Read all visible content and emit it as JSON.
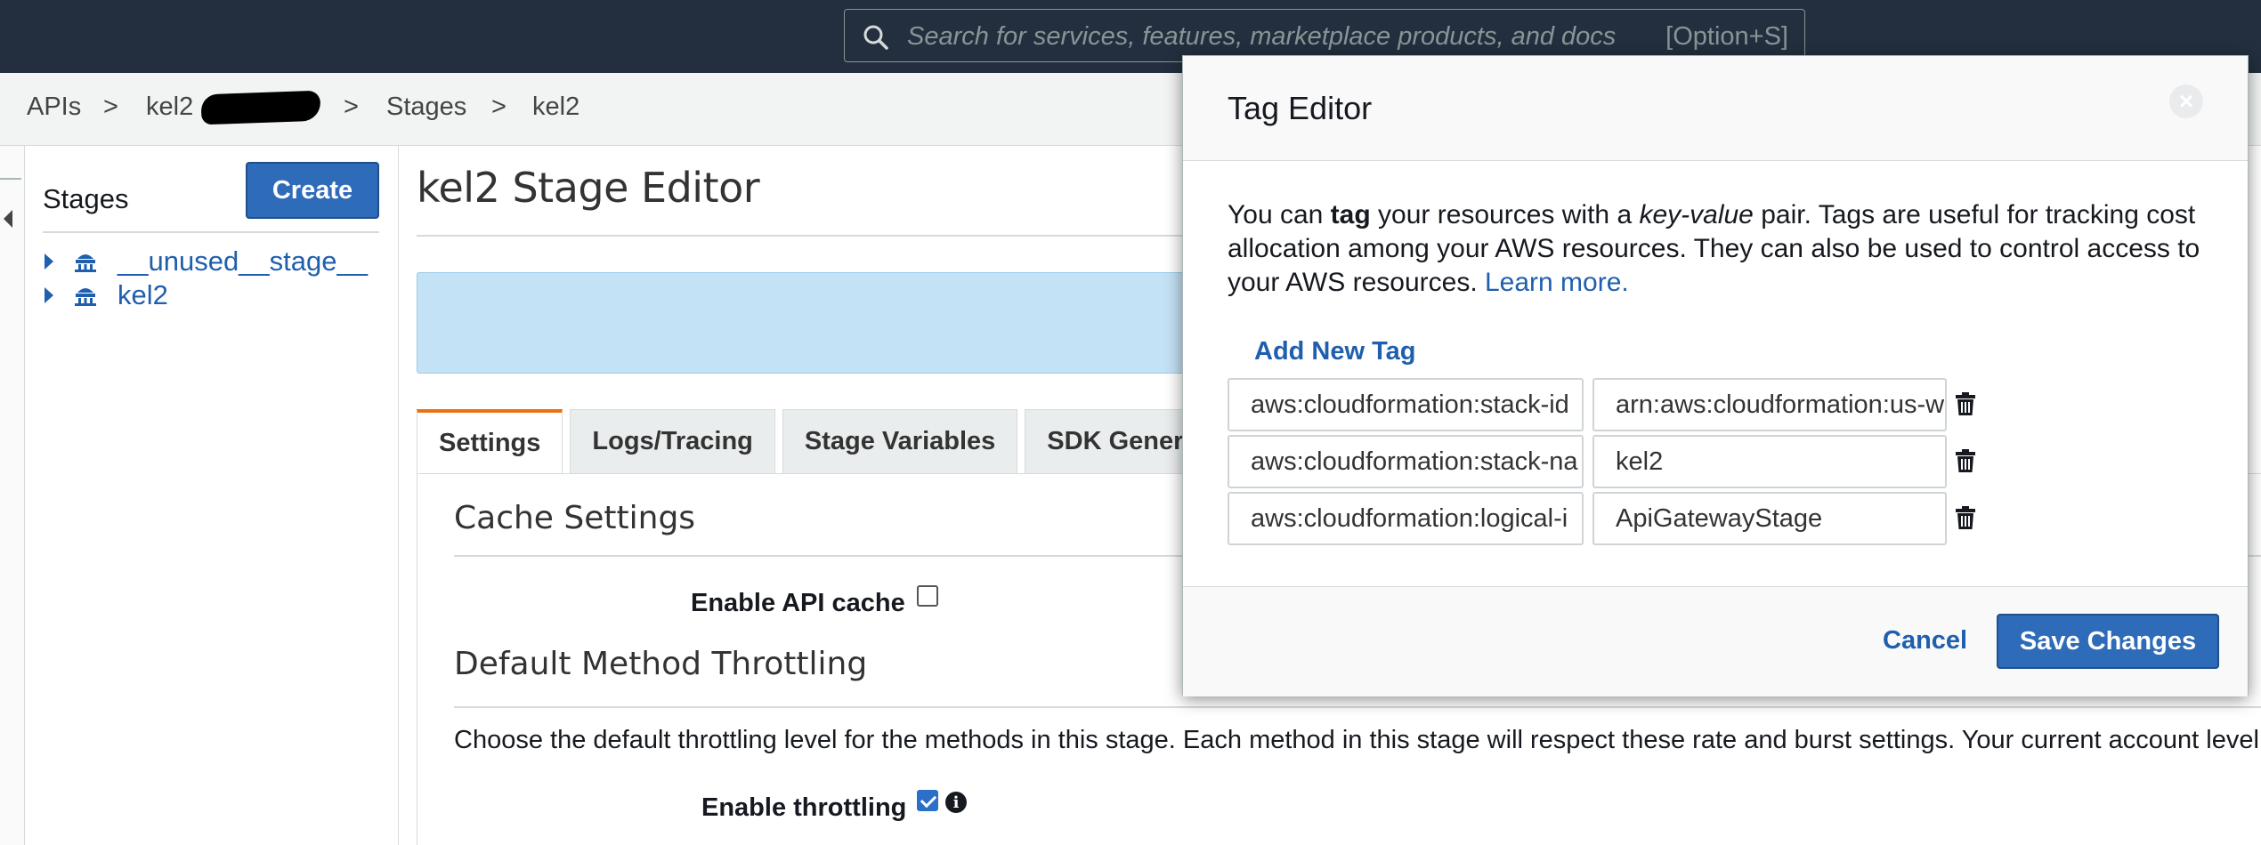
{
  "search": {
    "placeholder": "Search for services, features, marketplace products, and docs",
    "shortcut": "[Option+S]"
  },
  "breadcrumb": {
    "items": [
      "APIs",
      ">",
      "kel2",
      ">",
      "Stages",
      ">",
      "kel2"
    ]
  },
  "stages_panel": {
    "title": "Stages",
    "create_label": "Create",
    "items": [
      {
        "label": "__unused__stage__",
        "icon": "stage-icon"
      },
      {
        "label": "kel2",
        "icon": "stage-icon"
      }
    ]
  },
  "editor": {
    "title": "kel2 Stage Editor",
    "tabs": [
      "Settings",
      "Logs/Tracing",
      "Stage Variables",
      "SDK Generat"
    ],
    "cache_heading": "Cache Settings",
    "enable_cache_label": "Enable API cache",
    "enable_cache_checked": false,
    "throttling_heading": "Default Method Throttling",
    "throttling_desc": "Choose the default throttling level for the methods in this stage. Each method in this stage will respect these rate and burst settings. Your current account level thr",
    "enable_throttling_label": "Enable throttling",
    "enable_throttling_checked": true
  },
  "modal": {
    "title": "Tag Editor",
    "desc_parts": {
      "p1": "You can ",
      "bold": "tag",
      "p2": " your resources with a ",
      "italic": "key-value",
      "p3": " pair. Tags are useful for tracking cost allocation among your AWS resources. They can also be used to control access to your AWS resources. ",
      "link": "Learn more."
    },
    "add_tag_label": "Add New Tag",
    "tags": [
      {
        "key": "aws:cloudformation:stack-id",
        "value": "arn:aws:cloudformation:us-w"
      },
      {
        "key": "aws:cloudformation:stack-na",
        "value": "kel2"
      },
      {
        "key": "aws:cloudformation:logical-i",
        "value": "ApiGatewayStage"
      }
    ],
    "cancel_label": "Cancel",
    "save_label": "Save Changes"
  },
  "colors": {
    "nav_bg": "#232f3e",
    "primary_button": "#2e6bb8",
    "link": "#1f5fae",
    "tab_accent": "#ec7211",
    "info_box": "#c4e2f5"
  }
}
